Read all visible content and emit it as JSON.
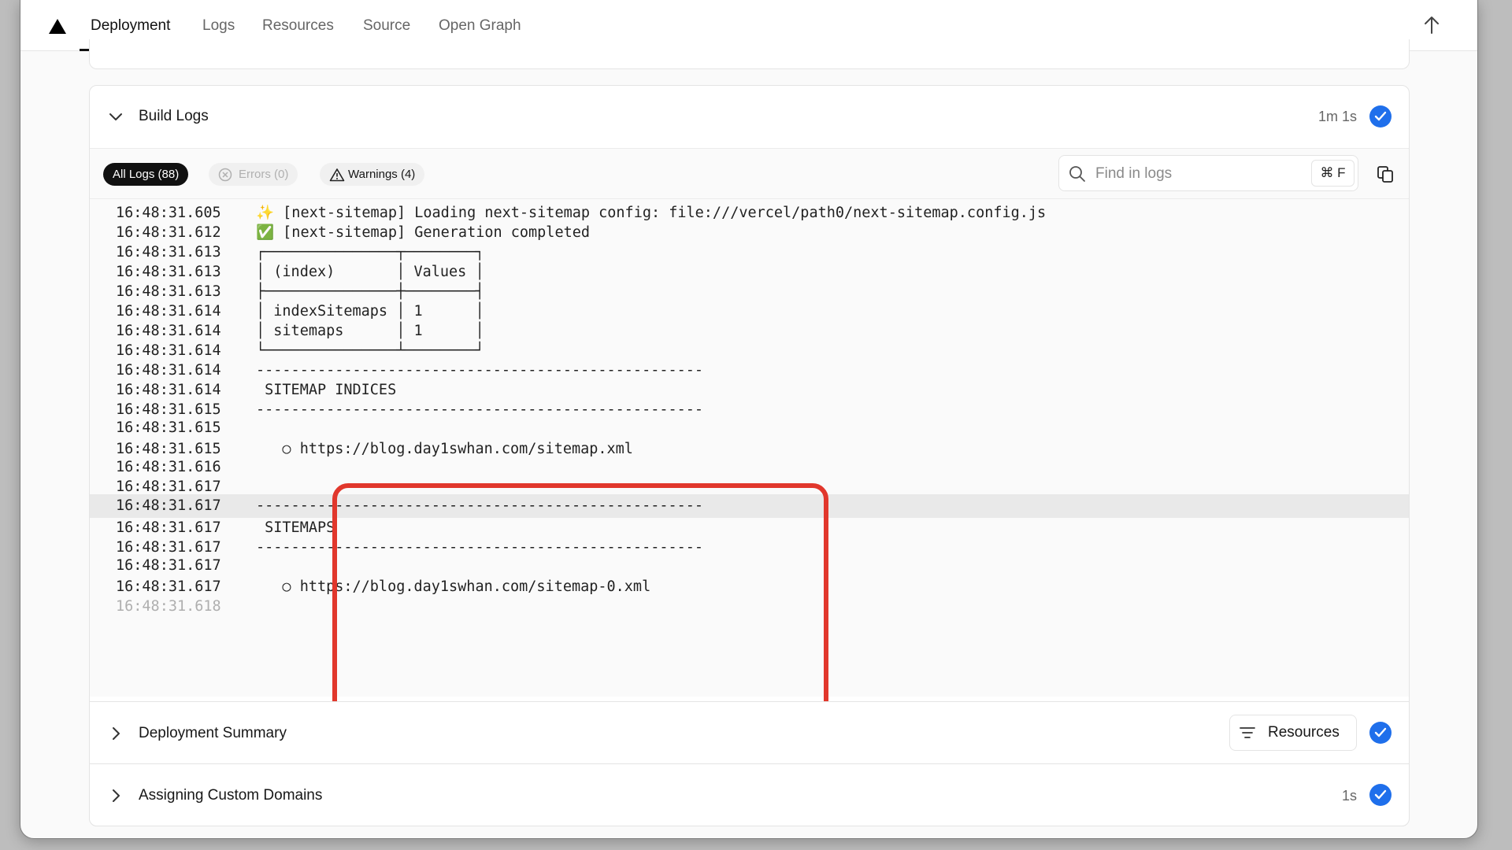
{
  "nav": {
    "tabs": [
      {
        "label": "Deployment",
        "active": true
      },
      {
        "label": "Logs"
      },
      {
        "label": "Resources"
      },
      {
        "label": "Source"
      },
      {
        "label": "Open Graph"
      }
    ]
  },
  "build_logs": {
    "title": "Build Logs",
    "duration": "1m 1s",
    "status": "success",
    "filters": {
      "all": "All Logs (88)",
      "errors": "Errors (0)",
      "warnings": "Warnings (4)"
    },
    "search": {
      "placeholder": "Find in logs",
      "shortcut": "⌘ F"
    },
    "lines": [
      {
        "ts": "16:48:31.605",
        "msg": "✨ [next-sitemap] Loading next-sitemap config: file:///vercel/path0/next-sitemap.config.js"
      },
      {
        "ts": "16:48:31.612",
        "msg": "✅ [next-sitemap] Generation completed"
      },
      {
        "ts": "16:48:31.613",
        "msg": "┌───────────────┬────────┐"
      },
      {
        "ts": "16:48:31.613",
        "msg": "│ (index)       │ Values │"
      },
      {
        "ts": "16:48:31.613",
        "msg": "├───────────────┼────────┤"
      },
      {
        "ts": "16:48:31.614",
        "msg": "│ indexSitemaps │ 1      │"
      },
      {
        "ts": "16:48:31.614",
        "msg": "│ sitemaps      │ 1      │"
      },
      {
        "ts": "16:48:31.614",
        "msg": "└───────────────┴────────┘"
      },
      {
        "ts": "16:48:31.614",
        "msg": "---------------------------------------------------"
      },
      {
        "ts": "16:48:31.614",
        "msg": " SITEMAP INDICES"
      },
      {
        "ts": "16:48:31.615",
        "msg": "---------------------------------------------------"
      },
      {
        "ts": "16:48:31.615",
        "msg": ""
      },
      {
        "ts": "16:48:31.615",
        "msg": "   ○ https://blog.day1swhan.com/sitemap.xml"
      },
      {
        "ts": "16:48:31.616",
        "msg": ""
      },
      {
        "ts": "16:48:31.617",
        "msg": ""
      },
      {
        "ts": "16:48:31.617",
        "msg": "---------------------------------------------------"
      },
      {
        "ts": "16:48:31.617",
        "msg": " SITEMAPS"
      },
      {
        "ts": "16:48:31.617",
        "msg": "---------------------------------------------------"
      },
      {
        "ts": "16:48:31.617",
        "msg": ""
      },
      {
        "ts": "16:48:31.617",
        "msg": "   ○ https://blog.day1swhan.com/sitemap-0.xml"
      },
      {
        "ts": "16:48:31.618",
        "msg": ""
      }
    ]
  },
  "deployment_summary": {
    "title": "Deployment Summary",
    "resources_label": "Resources"
  },
  "custom_domains": {
    "title": "Assigning Custom Domains",
    "duration": "1s"
  },
  "colors": {
    "accent": "#1f6feb",
    "highlight": "#e1372c"
  }
}
